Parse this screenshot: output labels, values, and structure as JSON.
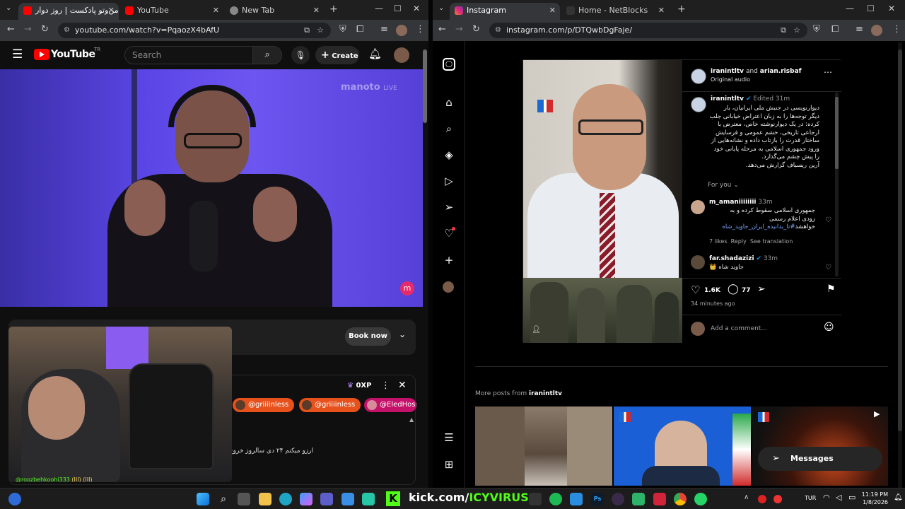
{
  "left_browser": {
    "tabs": [
      {
        "title": "من‌وتو پادکست | روز دوار",
        "icon": "youtube-favicon",
        "active": true
      },
      {
        "title": "YouTube",
        "icon": "youtube-favicon",
        "active": false
      },
      {
        "title": "New Tab",
        "icon": "chrome-favicon",
        "active": false
      }
    ],
    "url": "youtube.com/watch?v=PqaozX4bAfU"
  },
  "youtube": {
    "logo_text": "YouTube",
    "logo_region": "TR",
    "search_placeholder": "Search",
    "create_label": "Create",
    "watermark": "manoto",
    "watermark_live": "LIVE",
    "book_now_label": "Book now",
    "xp_label": "0XP",
    "chat_tags": [
      "@griiiinless",
      "@griiiinless",
      "@EledHoss"
    ],
    "chat_message": "آرزو میکنم ۲۴ دی سالروز خروج شاه ...",
    "webcam_username": "@roozbehkoohi333",
    "webcam_emotes": "(III) (III)"
  },
  "right_browser": {
    "tabs": [
      {
        "title": "Instagram",
        "icon": "instagram-favicon",
        "active": true
      },
      {
        "title": "Home - NetBlocks",
        "icon": "netblocks-favicon",
        "active": false
      }
    ],
    "url": "instagram.com/p/DTQwbDgFaje/"
  },
  "instagram": {
    "post_header": {
      "author": "iranintltv",
      "and": "and",
      "coauthor": "arian.risbaf",
      "audio": "Original audio"
    },
    "caption": {
      "author": "iranintltv",
      "edited": "Edited",
      "time": "31m",
      "text_lines": [
        "دیوارنویسی در جنبش ملی ایرانیان، بار",
        "دیگر توجه‌ها را به زبان اعتراض خیابانی جلب",
        "کرده: در یک دیوارنوشته خاص، معترض با",
        "ارجاعی تاریخی، خشم عمومی و فرسایش",
        "ساختار قدرت را بازتاب داده و نشانه‌هایی از",
        "ورود جمهوری اسلامی به مرحله پایانی خود",
        "را پیش چشم می‌گذارد.",
        "آرین ریسباف گزارش می‌دهد."
      ],
      "for_you": "For you"
    },
    "comments": [
      {
        "user": "m_amaniiiiiiii",
        "time": "33m",
        "lines": [
          "جمهوری اسلامی سقوط کرده و به",
          "زودی اعلام رسمی",
          "خواهشد"
        ],
        "hashtag": "#تا_بدانیده_ایران_جاوید_شاه",
        "likes": "7 likes",
        "reply": "Reply",
        "translate": "See translation"
      },
      {
        "user": "far.shadazizi",
        "time": "33m",
        "lines": [
          "جاوید شاه"
        ],
        "emoji": "👑"
      }
    ],
    "likes_count": "1.6K",
    "comments_count": "77",
    "post_time": "34 minutes ago",
    "add_comment_placeholder": "Add a comment...",
    "more_posts_label": "More posts from",
    "more_posts_user": "iranintltv",
    "messages_label": "Messages"
  },
  "taskbar": {
    "kick_text": "kick.com/",
    "kick_user": "ICYVIRUS",
    "language": "TUR",
    "time": "11:19 PM",
    "date": "1/8/2026"
  },
  "colors": {
    "youtube_red": "#ff0000",
    "kick_green": "#53fc18",
    "instagram_blue": "#0095f6",
    "video_purple": "#5b46e6"
  }
}
